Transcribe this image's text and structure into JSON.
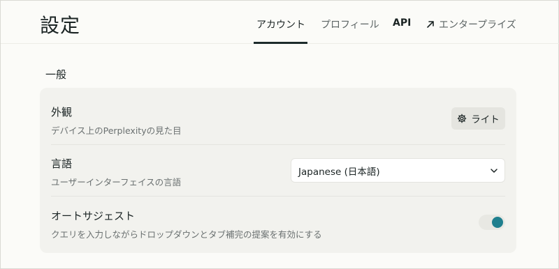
{
  "page": {
    "title": "設定"
  },
  "tabs": [
    {
      "label": "アカウント",
      "active": true
    },
    {
      "label": "プロフィール",
      "active": false
    },
    {
      "label": "API",
      "active": false
    },
    {
      "label": "エンタープライズ",
      "active": false,
      "icon": "external-arrow-icon"
    }
  ],
  "section": {
    "title": "一般"
  },
  "settings": {
    "appearance": {
      "title": "外観",
      "description": "デバイス上のPerplexityの見た目",
      "button_label": "ライト",
      "button_icon": "gear-icon"
    },
    "language": {
      "title": "言語",
      "description": "ユーザーインターフェイスの言語",
      "selected": "Japanese (日本語)",
      "icon": "chevron-down-icon"
    },
    "autosuggest": {
      "title": "オートサジェスト",
      "description": "クエリを入力しながらドロップダウンとタブ補完の提案を有効にする",
      "enabled": true
    }
  },
  "colors": {
    "accent": "#1f7f8e",
    "background": "#fbfbf8",
    "card": "#f2f2ee",
    "text": "#1b2424"
  }
}
